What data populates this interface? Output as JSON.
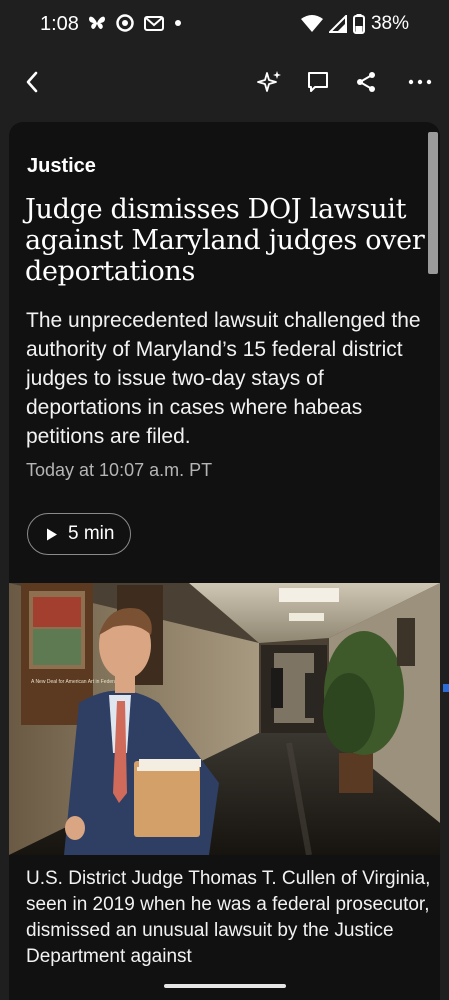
{
  "status_bar": {
    "time": "1:08",
    "battery": "38%"
  },
  "article": {
    "section": "Justice",
    "headline": "Judge dismisses DOJ lawsuit against Maryland judges over deportations",
    "dek": "The unprecedented lawsuit challenged the authority of Maryland’s 15 federal district judges to issue two-day stays of deportations in cases where habeas petitions are filed.",
    "timestamp": "Today at 10:07 a.m. PT",
    "listen_label": "5 min",
    "photo_sign_text": "A New Deal for American Art in Federal Buildings",
    "caption": "U.S. District Judge Thomas T. Cullen of Virginia, seen in 2019 when he was a federal prosecutor, dismissed an unusual lawsuit by the Justice Department against"
  },
  "colors": {
    "background": "#1f1f1f",
    "card": "#111111",
    "text": "#ffffff",
    "muted": "#b5b5b5"
  },
  "icons": [
    "back-arrow-icon",
    "ai-sparkle-icon",
    "comment-icon",
    "share-icon",
    "more-icon",
    "play-icon"
  ]
}
